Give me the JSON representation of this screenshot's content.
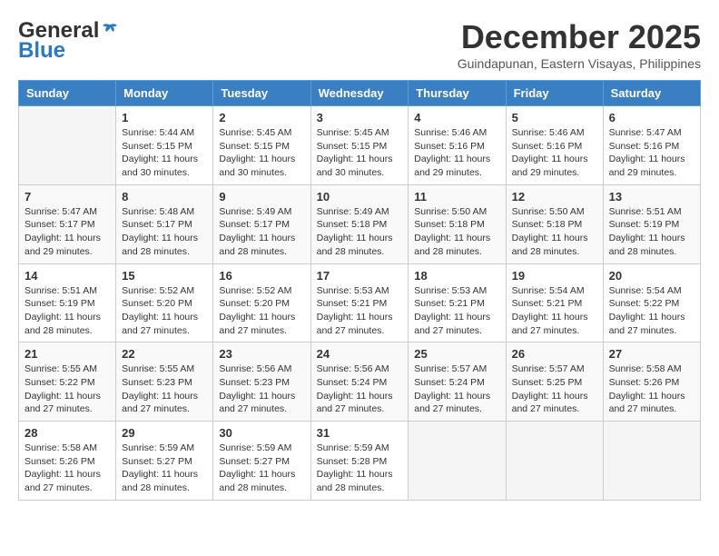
{
  "logo": {
    "general": "General",
    "blue": "Blue"
  },
  "title": {
    "month_year": "December 2025",
    "location": "Guindapunan, Eastern Visayas, Philippines"
  },
  "headers": [
    "Sunday",
    "Monday",
    "Tuesday",
    "Wednesday",
    "Thursday",
    "Friday",
    "Saturday"
  ],
  "weeks": [
    [
      {
        "day": "",
        "info": ""
      },
      {
        "day": "1",
        "info": "Sunrise: 5:44 AM\nSunset: 5:15 PM\nDaylight: 11 hours\nand 30 minutes."
      },
      {
        "day": "2",
        "info": "Sunrise: 5:45 AM\nSunset: 5:15 PM\nDaylight: 11 hours\nand 30 minutes."
      },
      {
        "day": "3",
        "info": "Sunrise: 5:45 AM\nSunset: 5:15 PM\nDaylight: 11 hours\nand 30 minutes."
      },
      {
        "day": "4",
        "info": "Sunrise: 5:46 AM\nSunset: 5:16 PM\nDaylight: 11 hours\nand 29 minutes."
      },
      {
        "day": "5",
        "info": "Sunrise: 5:46 AM\nSunset: 5:16 PM\nDaylight: 11 hours\nand 29 minutes."
      },
      {
        "day": "6",
        "info": "Sunrise: 5:47 AM\nSunset: 5:16 PM\nDaylight: 11 hours\nand 29 minutes."
      }
    ],
    [
      {
        "day": "7",
        "info": "Sunrise: 5:47 AM\nSunset: 5:17 PM\nDaylight: 11 hours\nand 29 minutes."
      },
      {
        "day": "8",
        "info": "Sunrise: 5:48 AM\nSunset: 5:17 PM\nDaylight: 11 hours\nand 28 minutes."
      },
      {
        "day": "9",
        "info": "Sunrise: 5:49 AM\nSunset: 5:17 PM\nDaylight: 11 hours\nand 28 minutes."
      },
      {
        "day": "10",
        "info": "Sunrise: 5:49 AM\nSunset: 5:18 PM\nDaylight: 11 hours\nand 28 minutes."
      },
      {
        "day": "11",
        "info": "Sunrise: 5:50 AM\nSunset: 5:18 PM\nDaylight: 11 hours\nand 28 minutes."
      },
      {
        "day": "12",
        "info": "Sunrise: 5:50 AM\nSunset: 5:18 PM\nDaylight: 11 hours\nand 28 minutes."
      },
      {
        "day": "13",
        "info": "Sunrise: 5:51 AM\nSunset: 5:19 PM\nDaylight: 11 hours\nand 28 minutes."
      }
    ],
    [
      {
        "day": "14",
        "info": "Sunrise: 5:51 AM\nSunset: 5:19 PM\nDaylight: 11 hours\nand 28 minutes."
      },
      {
        "day": "15",
        "info": "Sunrise: 5:52 AM\nSunset: 5:20 PM\nDaylight: 11 hours\nand 27 minutes."
      },
      {
        "day": "16",
        "info": "Sunrise: 5:52 AM\nSunset: 5:20 PM\nDaylight: 11 hours\nand 27 minutes."
      },
      {
        "day": "17",
        "info": "Sunrise: 5:53 AM\nSunset: 5:21 PM\nDaylight: 11 hours\nand 27 minutes."
      },
      {
        "day": "18",
        "info": "Sunrise: 5:53 AM\nSunset: 5:21 PM\nDaylight: 11 hours\nand 27 minutes."
      },
      {
        "day": "19",
        "info": "Sunrise: 5:54 AM\nSunset: 5:21 PM\nDaylight: 11 hours\nand 27 minutes."
      },
      {
        "day": "20",
        "info": "Sunrise: 5:54 AM\nSunset: 5:22 PM\nDaylight: 11 hours\nand 27 minutes."
      }
    ],
    [
      {
        "day": "21",
        "info": "Sunrise: 5:55 AM\nSunset: 5:22 PM\nDaylight: 11 hours\nand 27 minutes."
      },
      {
        "day": "22",
        "info": "Sunrise: 5:55 AM\nSunset: 5:23 PM\nDaylight: 11 hours\nand 27 minutes."
      },
      {
        "day": "23",
        "info": "Sunrise: 5:56 AM\nSunset: 5:23 PM\nDaylight: 11 hours\nand 27 minutes."
      },
      {
        "day": "24",
        "info": "Sunrise: 5:56 AM\nSunset: 5:24 PM\nDaylight: 11 hours\nand 27 minutes."
      },
      {
        "day": "25",
        "info": "Sunrise: 5:57 AM\nSunset: 5:24 PM\nDaylight: 11 hours\nand 27 minutes."
      },
      {
        "day": "26",
        "info": "Sunrise: 5:57 AM\nSunset: 5:25 PM\nDaylight: 11 hours\nand 27 minutes."
      },
      {
        "day": "27",
        "info": "Sunrise: 5:58 AM\nSunset: 5:26 PM\nDaylight: 11 hours\nand 27 minutes."
      }
    ],
    [
      {
        "day": "28",
        "info": "Sunrise: 5:58 AM\nSunset: 5:26 PM\nDaylight: 11 hours\nand 27 minutes."
      },
      {
        "day": "29",
        "info": "Sunrise: 5:59 AM\nSunset: 5:27 PM\nDaylight: 11 hours\nand 28 minutes."
      },
      {
        "day": "30",
        "info": "Sunrise: 5:59 AM\nSunset: 5:27 PM\nDaylight: 11 hours\nand 28 minutes."
      },
      {
        "day": "31",
        "info": "Sunrise: 5:59 AM\nSunset: 5:28 PM\nDaylight: 11 hours\nand 28 minutes."
      },
      {
        "day": "",
        "info": ""
      },
      {
        "day": "",
        "info": ""
      },
      {
        "day": "",
        "info": ""
      }
    ]
  ]
}
